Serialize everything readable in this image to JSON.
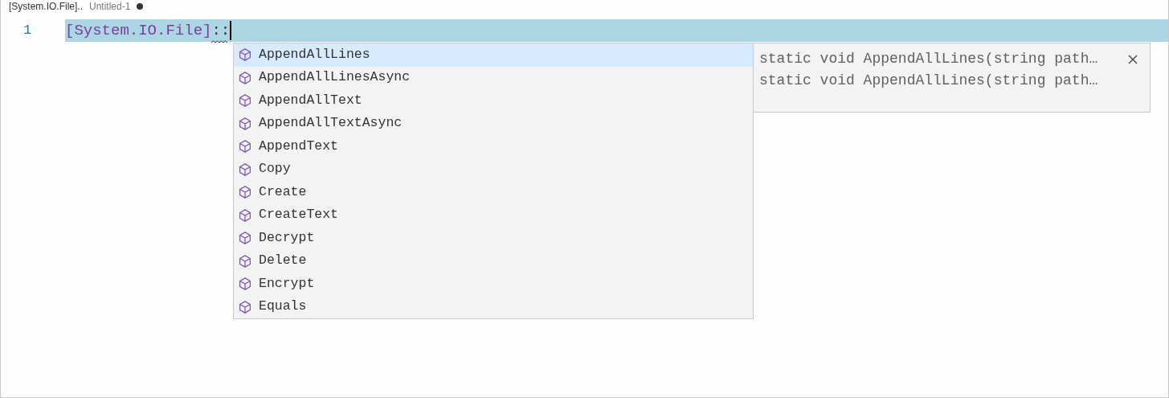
{
  "tab": {
    "title": "[System.IO.File]..",
    "subtitle": "Untitled-1",
    "dirty": true
  },
  "editor": {
    "lines": [
      {
        "number": "1",
        "type_name": "[System.IO.File]",
        "rest": "::",
        "highlighted": true
      }
    ]
  },
  "suggestions": [
    {
      "label": "AppendAllLines",
      "selected": true
    },
    {
      "label": "AppendAllLinesAsync",
      "selected": false
    },
    {
      "label": "AppendAllText",
      "selected": false
    },
    {
      "label": "AppendAllTextAsync",
      "selected": false
    },
    {
      "label": "AppendText",
      "selected": false
    },
    {
      "label": "Copy",
      "selected": false
    },
    {
      "label": "Create",
      "selected": false
    },
    {
      "label": "CreateText",
      "selected": false
    },
    {
      "label": "Decrypt",
      "selected": false
    },
    {
      "label": "Delete",
      "selected": false
    },
    {
      "label": "Encrypt",
      "selected": false
    },
    {
      "label": "Equals",
      "selected": false
    }
  ],
  "details": [
    "static void AppendAllLines(string path…",
    "static void AppendAllLines(string path…"
  ]
}
